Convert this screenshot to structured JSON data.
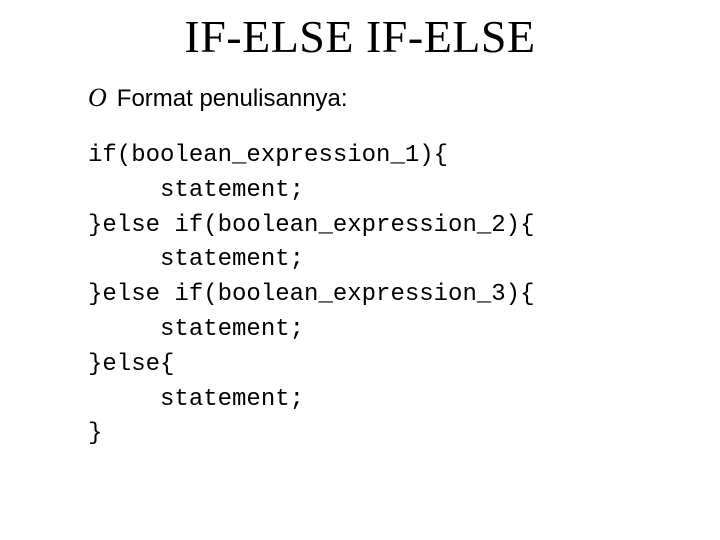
{
  "title": "IF-ELSE IF-ELSE",
  "bullet": {
    "marker": "O",
    "text": "Format penulisannya:"
  },
  "code": "if(boolean_expression_1){\n     statement;\n}else if(boolean_expression_2){\n     statement;\n}else if(boolean_expression_3){\n     statement;\n}else{\n     statement;\n}"
}
